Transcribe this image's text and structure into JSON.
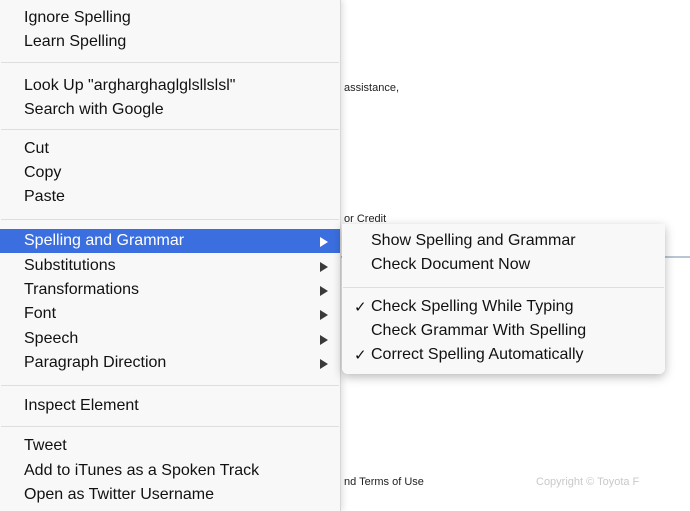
{
  "background": {
    "assistance_fragment": "assistance,",
    "credit_fragment": "or Credit",
    "terms_fragment": "nd Terms of Use",
    "copyright_fragment": "Copyright © Toyota F"
  },
  "menu": {
    "ignore_spelling": "Ignore Spelling",
    "learn_spelling": "Learn Spelling",
    "look_up": "Look Up \"argharghaglglsllslsl\"",
    "search_google": "Search with Google",
    "cut": "Cut",
    "copy": "Copy",
    "paste": "Paste",
    "spelling_grammar": "Spelling and Grammar",
    "substitutions": "Substitutions",
    "transformations": "Transformations",
    "font": "Font",
    "speech": "Speech",
    "paragraph_direction": "Paragraph Direction",
    "inspect_element": "Inspect Element",
    "tweet": "Tweet",
    "add_itunes": "Add to iTunes as a Spoken Track",
    "open_twitter": "Open as Twitter Username"
  },
  "submenu": {
    "show_spelling": "Show Spelling and Grammar",
    "check_document": "Check Document Now",
    "check_spelling_typing": "Check Spelling While Typing",
    "check_spelling_typing_checked": true,
    "check_grammar": "Check Grammar With Spelling",
    "check_grammar_checked": false,
    "correct_spelling": "Correct Spelling Automatically",
    "correct_spelling_checked": true,
    "check_mark": "✓"
  },
  "colors": {
    "highlight": "#3b6fe0",
    "menu_bg": "#f8f8f8",
    "separator": "#dedede"
  },
  "icons": {
    "submenu_arrow": "submenu-arrow-icon",
    "check": "check-icon"
  }
}
